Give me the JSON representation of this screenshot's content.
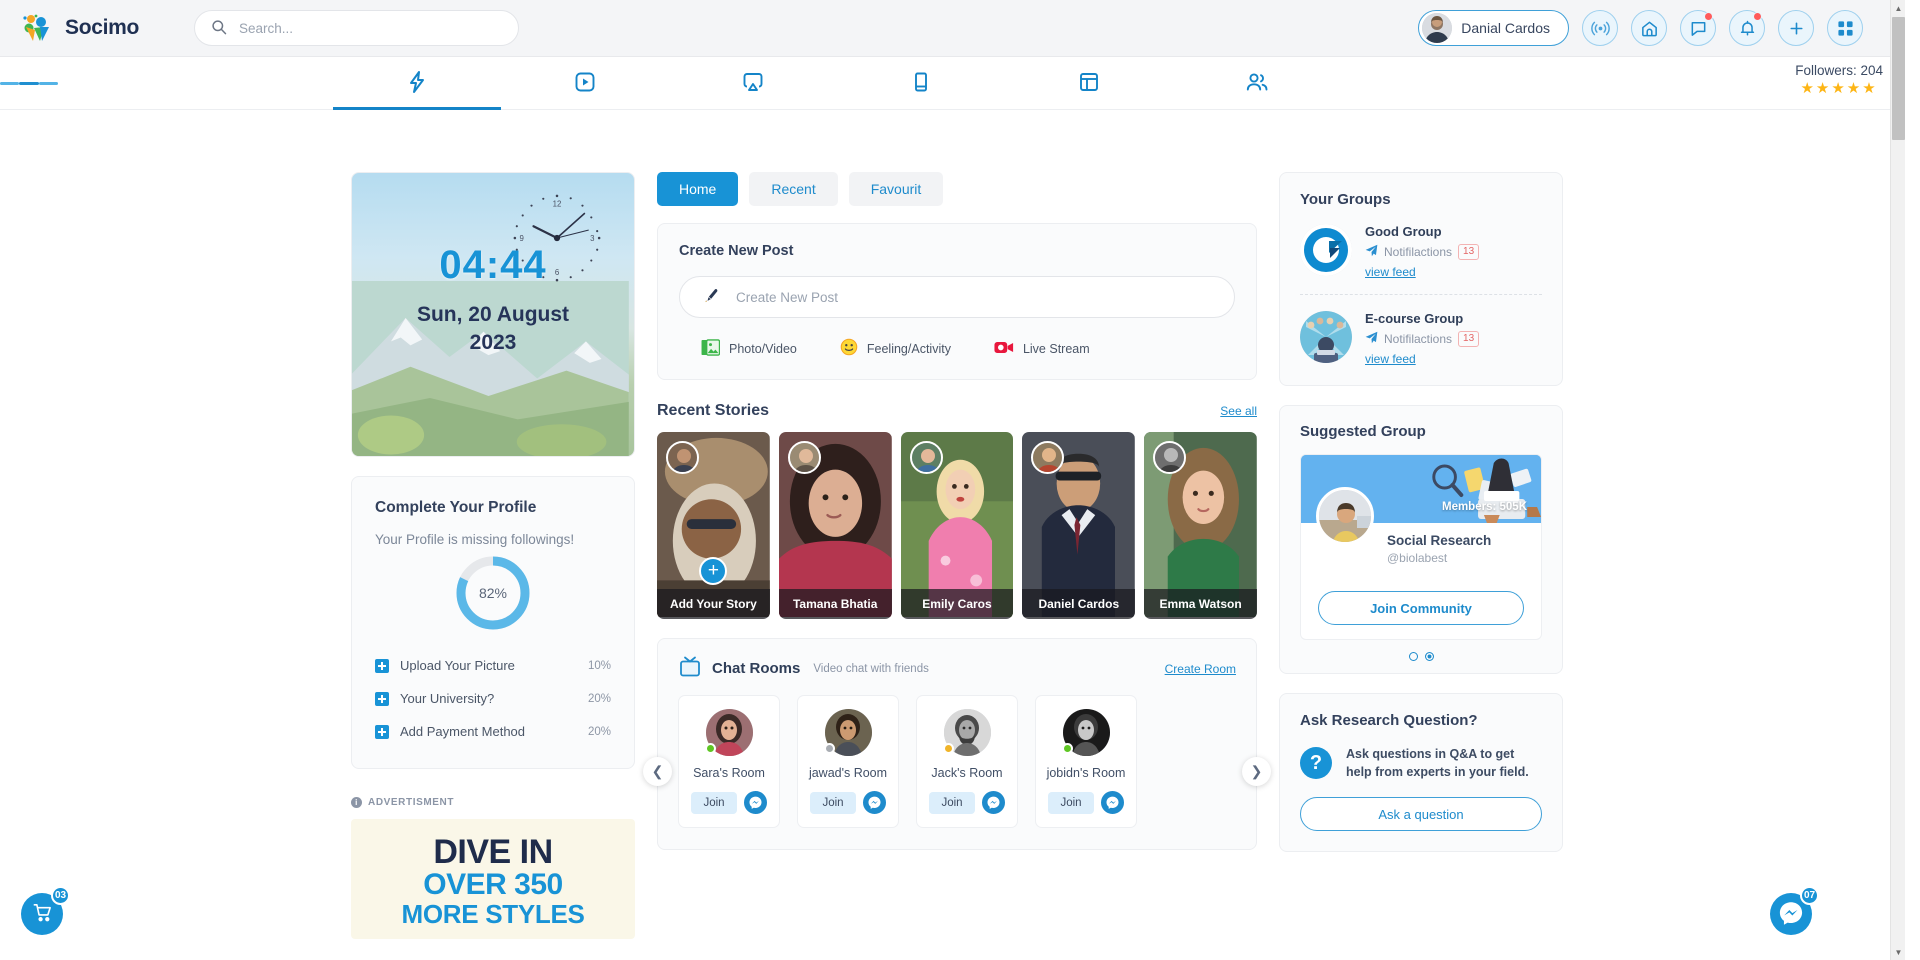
{
  "brand": {
    "name": "Socimo"
  },
  "search": {
    "placeholder": "Search...",
    "value": ""
  },
  "header": {
    "user_name": "Danial Cardos",
    "icons": [
      {
        "name": "broadcast-icon",
        "badge": ""
      },
      {
        "name": "home-icon",
        "badge": ""
      },
      {
        "name": "chat-icon",
        "badge": "dot"
      },
      {
        "name": "bell-icon",
        "badge": "dot"
      },
      {
        "name": "plus-icon",
        "badge": ""
      },
      {
        "name": "grid-icon",
        "badge": ""
      }
    ]
  },
  "nav": {
    "menu_icon": "hamburger-icon",
    "tabs": [
      {
        "icon": "lightning-icon",
        "active": true
      },
      {
        "icon": "video-play-icon",
        "active": false
      },
      {
        "icon": "airplay-icon",
        "active": false
      },
      {
        "icon": "book-icon",
        "active": false
      },
      {
        "icon": "layout-icon",
        "active": false
      },
      {
        "icon": "people-icon",
        "active": false
      }
    ],
    "followers_label": "Followers: 204",
    "stars": "★★★★★"
  },
  "clock": {
    "time": "04:44",
    "date_line1": "Sun, 20 August",
    "date_line2": "2023",
    "face_labels": [
      "12",
      "3",
      "6",
      "9"
    ]
  },
  "profile": {
    "title": "Complete Your Profile",
    "subtitle": "Your Profile is missing followings!",
    "percent": "82%",
    "percent_value": 82,
    "items": [
      {
        "label": "Upload Your Picture",
        "amount": "10%"
      },
      {
        "label": "Your University?",
        "amount": "20%"
      },
      {
        "label": "Add Payment Method",
        "amount": "20%"
      }
    ]
  },
  "ad": {
    "label": "ADVERTISMENT",
    "line1": "DIVE IN",
    "line2": "OVER 350",
    "line3": "MORE STYLES"
  },
  "feed_tabs": [
    {
      "label": "Home",
      "active": true
    },
    {
      "label": "Recent",
      "active": false
    },
    {
      "label": "Favourit",
      "active": false
    }
  ],
  "create_post": {
    "title": "Create New Post",
    "placeholder": "Create New Post",
    "value": "",
    "actions": [
      {
        "label": "Photo/Video",
        "icon": "photo-icon"
      },
      {
        "label": "Feeling/Activity",
        "icon": "smiley-icon"
      },
      {
        "label": "Live Stream",
        "icon": "video-camera-icon"
      }
    ]
  },
  "stories": {
    "title": "Recent Stories",
    "see_all": "See all",
    "items": [
      {
        "name": "Add Your Story",
        "add": true,
        "bg": "#6b5a4c",
        "bg2": "#2d2620",
        "mini": "#8a6f56"
      },
      {
        "name": "Tamana Bhatia",
        "add": false,
        "bg": "#6e4a48",
        "bg2": "#2b1c1c",
        "mini": "#9a7464"
      },
      {
        "name": "Emily Caros",
        "add": false,
        "bg": "#5d7a48",
        "bg2": "#2c3a20",
        "mini": "#7f9a6a"
      },
      {
        "name": "Daniel Cardos",
        "add": false,
        "bg": "#4a4e58",
        "bg2": "#1d2026",
        "mini": "#8e7c64"
      },
      {
        "name": "Emma Watson",
        "add": false,
        "bg": "#4e6a4e",
        "bg2": "#22301f",
        "mini": "#6b6b6b"
      }
    ]
  },
  "chat_rooms": {
    "title": "Chat Rooms",
    "subtitle": "Video chat with friends",
    "create_label": "Create Room",
    "prev_icon": "chevron-left-icon",
    "next_icon": "chevron-right-icon",
    "rooms": [
      {
        "name": "Sara's Room",
        "join": "Join",
        "status": "#5fc624",
        "ava": "#9c6f72"
      },
      {
        "name": "jawad's Room",
        "join": "Join",
        "status": "#a9adb3",
        "ava": "#6b6350"
      },
      {
        "name": "Jack's Room",
        "join": "Join",
        "status": "#f0b429",
        "ava": "#8e8e8e"
      },
      {
        "name": "jobidn's Room",
        "join": "Join",
        "status": "#5fc624",
        "ava": "#3a3a3a"
      }
    ]
  },
  "your_groups": {
    "title": "Your Groups",
    "items": [
      {
        "name": "Good Group",
        "notif_label": "Notifilactions",
        "badge": "13",
        "link": "view feed",
        "color": "#0e8ad0"
      },
      {
        "name": "E-course Group",
        "notif_label": "Notifilactions",
        "badge": "13",
        "link": "view feed",
        "color": "#63b2d8"
      }
    ]
  },
  "suggested_group": {
    "title": "Suggested Group",
    "members": "Members: 505K",
    "name": "Social Research",
    "handle": "@biolabest",
    "join_label": "Join Community",
    "dots": [
      false,
      true
    ]
  },
  "ask": {
    "title": "Ask Research Question?",
    "text": "Ask questions in Q&A to get help from experts in your field.",
    "button": "Ask a question"
  },
  "floating": {
    "cart_badge": "03",
    "msg_badge": "07"
  },
  "colors": {
    "accent": "#1893d6",
    "accent_dark": "#1484c8",
    "star": "#fdb515",
    "badge_red": "#e36565"
  }
}
